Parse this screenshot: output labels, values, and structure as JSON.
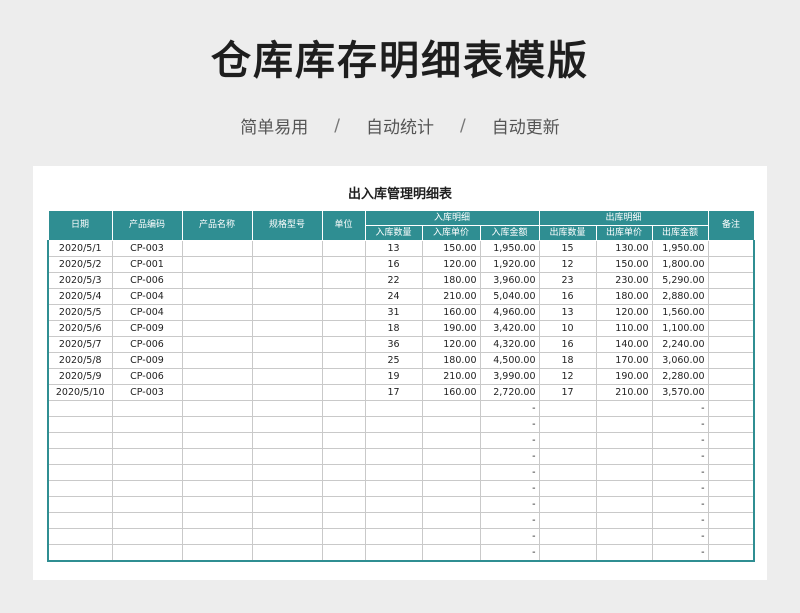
{
  "page": {
    "title": "仓库库存明细表模版",
    "tags": [
      "简单易用",
      "自动统计",
      "自动更新"
    ],
    "separator": "/"
  },
  "sheet": {
    "title": "出入库管理明细表",
    "headers": {
      "date": "日期",
      "product_code": "产品编码",
      "product_name": "产品名称",
      "spec": "规格型号",
      "unit": "单位",
      "in_group": "入库明细",
      "in_qty": "入库数量",
      "in_price": "入库单价",
      "in_amount": "入库金额",
      "out_group": "出库明细",
      "out_qty": "出库数量",
      "out_price": "出库单价",
      "out_amount": "出库金额",
      "remark": "备注"
    },
    "rows": [
      {
        "date": "2020/5/1",
        "code": "CP-003",
        "name": "",
        "spec": "",
        "unit": "",
        "in_qty": "13",
        "in_price": "150.00",
        "in_amount": "1,950.00",
        "out_qty": "15",
        "out_price": "130.00",
        "out_amount": "1,950.00",
        "remark": ""
      },
      {
        "date": "2020/5/2",
        "code": "CP-001",
        "name": "",
        "spec": "",
        "unit": "",
        "in_qty": "16",
        "in_price": "120.00",
        "in_amount": "1,920.00",
        "out_qty": "12",
        "out_price": "150.00",
        "out_amount": "1,800.00",
        "remark": ""
      },
      {
        "date": "2020/5/3",
        "code": "CP-006",
        "name": "",
        "spec": "",
        "unit": "",
        "in_qty": "22",
        "in_price": "180.00",
        "in_amount": "3,960.00",
        "out_qty": "23",
        "out_price": "230.00",
        "out_amount": "5,290.00",
        "remark": ""
      },
      {
        "date": "2020/5/4",
        "code": "CP-004",
        "name": "",
        "spec": "",
        "unit": "",
        "in_qty": "24",
        "in_price": "210.00",
        "in_amount": "5,040.00",
        "out_qty": "16",
        "out_price": "180.00",
        "out_amount": "2,880.00",
        "remark": ""
      },
      {
        "date": "2020/5/5",
        "code": "CP-004",
        "name": "",
        "spec": "",
        "unit": "",
        "in_qty": "31",
        "in_price": "160.00",
        "in_amount": "4,960.00",
        "out_qty": "13",
        "out_price": "120.00",
        "out_amount": "1,560.00",
        "remark": ""
      },
      {
        "date": "2020/5/6",
        "code": "CP-009",
        "name": "",
        "spec": "",
        "unit": "",
        "in_qty": "18",
        "in_price": "190.00",
        "in_amount": "3,420.00",
        "out_qty": "10",
        "out_price": "110.00",
        "out_amount": "1,100.00",
        "remark": ""
      },
      {
        "date": "2020/5/7",
        "code": "CP-006",
        "name": "",
        "spec": "",
        "unit": "",
        "in_qty": "36",
        "in_price": "120.00",
        "in_amount": "4,320.00",
        "out_qty": "16",
        "out_price": "140.00",
        "out_amount": "2,240.00",
        "remark": ""
      },
      {
        "date": "2020/5/8",
        "code": "CP-009",
        "name": "",
        "spec": "",
        "unit": "",
        "in_qty": "25",
        "in_price": "180.00",
        "in_amount": "4,500.00",
        "out_qty": "18",
        "out_price": "170.00",
        "out_amount": "3,060.00",
        "remark": ""
      },
      {
        "date": "2020/5/9",
        "code": "CP-006",
        "name": "",
        "spec": "",
        "unit": "",
        "in_qty": "19",
        "in_price": "210.00",
        "in_amount": "3,990.00",
        "out_qty": "12",
        "out_price": "190.00",
        "out_amount": "2,280.00",
        "remark": ""
      },
      {
        "date": "2020/5/10",
        "code": "CP-003",
        "name": "",
        "spec": "",
        "unit": "",
        "in_qty": "17",
        "in_price": "160.00",
        "in_amount": "2,720.00",
        "out_qty": "17",
        "out_price": "210.00",
        "out_amount": "3,570.00",
        "remark": ""
      },
      {
        "date": "",
        "code": "",
        "name": "",
        "spec": "",
        "unit": "",
        "in_qty": "",
        "in_price": "",
        "in_amount": "-",
        "out_qty": "",
        "out_price": "",
        "out_amount": "-",
        "remark": ""
      },
      {
        "date": "",
        "code": "",
        "name": "",
        "spec": "",
        "unit": "",
        "in_qty": "",
        "in_price": "",
        "in_amount": "-",
        "out_qty": "",
        "out_price": "",
        "out_amount": "-",
        "remark": ""
      },
      {
        "date": "",
        "code": "",
        "name": "",
        "spec": "",
        "unit": "",
        "in_qty": "",
        "in_price": "",
        "in_amount": "-",
        "out_qty": "",
        "out_price": "",
        "out_amount": "-",
        "remark": ""
      },
      {
        "date": "",
        "code": "",
        "name": "",
        "spec": "",
        "unit": "",
        "in_qty": "",
        "in_price": "",
        "in_amount": "-",
        "out_qty": "",
        "out_price": "",
        "out_amount": "-",
        "remark": ""
      },
      {
        "date": "",
        "code": "",
        "name": "",
        "spec": "",
        "unit": "",
        "in_qty": "",
        "in_price": "",
        "in_amount": "-",
        "out_qty": "",
        "out_price": "",
        "out_amount": "-",
        "remark": ""
      },
      {
        "date": "",
        "code": "",
        "name": "",
        "spec": "",
        "unit": "",
        "in_qty": "",
        "in_price": "",
        "in_amount": "-",
        "out_qty": "",
        "out_price": "",
        "out_amount": "-",
        "remark": ""
      },
      {
        "date": "",
        "code": "",
        "name": "",
        "spec": "",
        "unit": "",
        "in_qty": "",
        "in_price": "",
        "in_amount": "-",
        "out_qty": "",
        "out_price": "",
        "out_amount": "-",
        "remark": ""
      },
      {
        "date": "",
        "code": "",
        "name": "",
        "spec": "",
        "unit": "",
        "in_qty": "",
        "in_price": "",
        "in_amount": "-",
        "out_qty": "",
        "out_price": "",
        "out_amount": "-",
        "remark": ""
      },
      {
        "date": "",
        "code": "",
        "name": "",
        "spec": "",
        "unit": "",
        "in_qty": "",
        "in_price": "",
        "in_amount": "-",
        "out_qty": "",
        "out_price": "",
        "out_amount": "-",
        "remark": ""
      },
      {
        "date": "",
        "code": "",
        "name": "",
        "spec": "",
        "unit": "",
        "in_qty": "",
        "in_price": "",
        "in_amount": "-",
        "out_qty": "",
        "out_price": "",
        "out_amount": "-",
        "remark": ""
      }
    ]
  },
  "colors": {
    "header_teal": "#2f8e92",
    "background": "#ededed"
  }
}
